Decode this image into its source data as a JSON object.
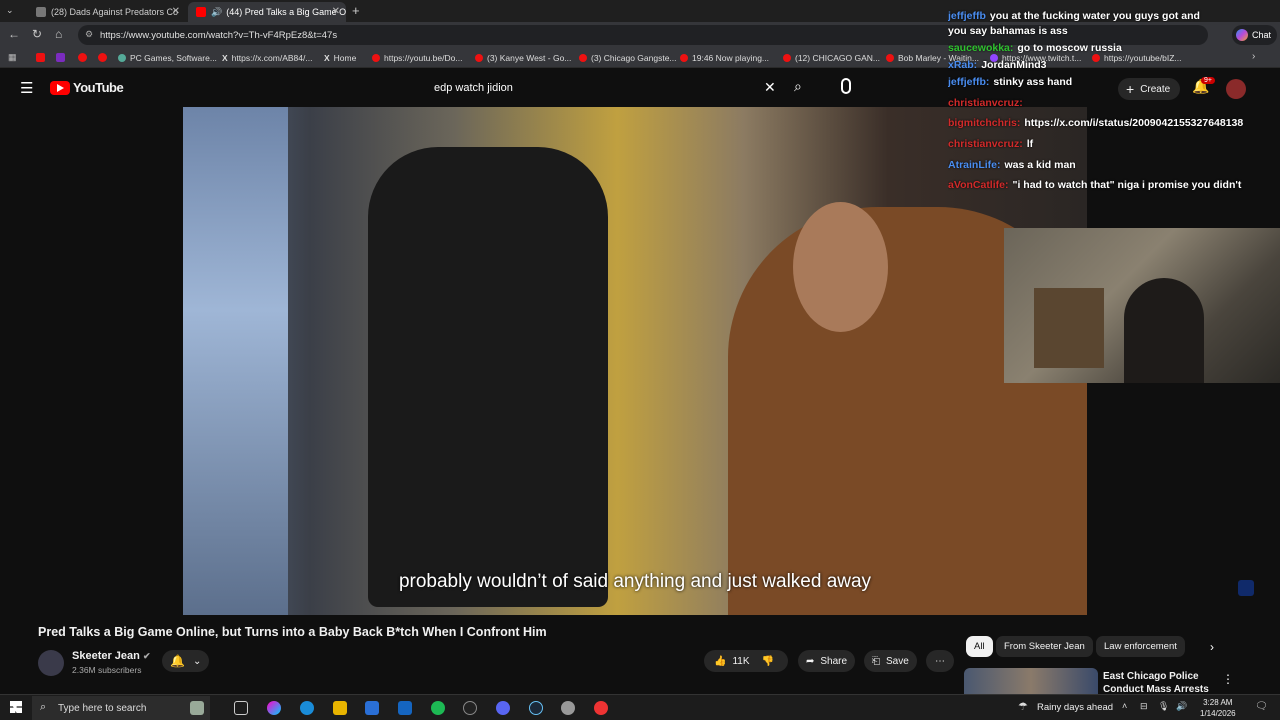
{
  "browser": {
    "tabs": [
      {
        "label": "(28) Dads Against Predators Co",
        "active": false
      },
      {
        "label": "(44) Pred Talks a Big Game O",
        "active": true
      }
    ],
    "new_tab": "+",
    "url": "https://www.youtube.com/watch?v=Th-vF4RpEz8&t=47s",
    "chat_button": "Chat",
    "bookmarks": [
      "PC Games, Software...",
      "https://x.com/AB84/...",
      "Home",
      "https://youtu.be/Do...",
      "(3) Kanye West - Go...",
      "(3) Chicago Gangste...",
      "19:46 Now playing...",
      "(12) CHICAGO GAN...",
      "Bob Marley - Waitin...",
      "https://www.twitch.t...",
      "https://youtube/bIZ..."
    ]
  },
  "youtube": {
    "logo_text": "YouTube",
    "search_value": "edp watch jidion",
    "create_label": "Create",
    "notification_badge": "9+"
  },
  "video": {
    "caption": "probably wouldn’t of said anything and just walked away",
    "title": "Pred Talks a Big Game Online, but Turns into a Baby Back B*tch When I Confront Him",
    "channel": "Skeeter Jean",
    "subscribers": "2.36M subscribers",
    "likes": "11K",
    "share_label": "Share",
    "save_label": "Save"
  },
  "chips": [
    "All",
    "From Skeeter Jean",
    "Law enforcement"
  ],
  "recommendation": {
    "title_line1": "East Chicago Police",
    "title_line2": "Conduct Mass Arrests"
  },
  "chat": [
    {
      "user": "jeffjeffb",
      "user_color": "#4a8df0",
      "text": "you at the fucking water you guys got and"
    },
    {
      "user": "",
      "user_color": "#ffffff",
      "text": "you say bahamas is ass"
    },
    {
      "user": "saucewokka:",
      "user_color": "#2fc12f",
      "text": "go to moscow russia"
    },
    {
      "user": "xRab:",
      "user_color": "#4a8df0",
      "text": "JordanMind3"
    },
    {
      "user": "jeffjeffb:",
      "user_color": "#4a8df0",
      "text": "stinky ass hand"
    },
    {
      "user": "christianvcruz:",
      "user_color": "#d12a2a",
      "text": ""
    },
    {
      "user": "bigmitchchris:",
      "user_color": "#d12a2a",
      "text": "https://x.com/i/status/2009042155327648138"
    },
    {
      "user": "christianvcruz:",
      "user_color": "#d12a2a",
      "text": "lf"
    },
    {
      "user": "AtrainLife:",
      "user_color": "#4a8df0",
      "text": "was a kid man"
    },
    {
      "user": "aVonCatlife:",
      "user_color": "#d12a2a",
      "text": "\"i had to watch that\" niga i promise you didn't"
    }
  ],
  "taskbar": {
    "search_placeholder": "Type here to search",
    "weather": "Rainy days ahead",
    "time": "3:28 AM",
    "date": "1/14/2026"
  }
}
